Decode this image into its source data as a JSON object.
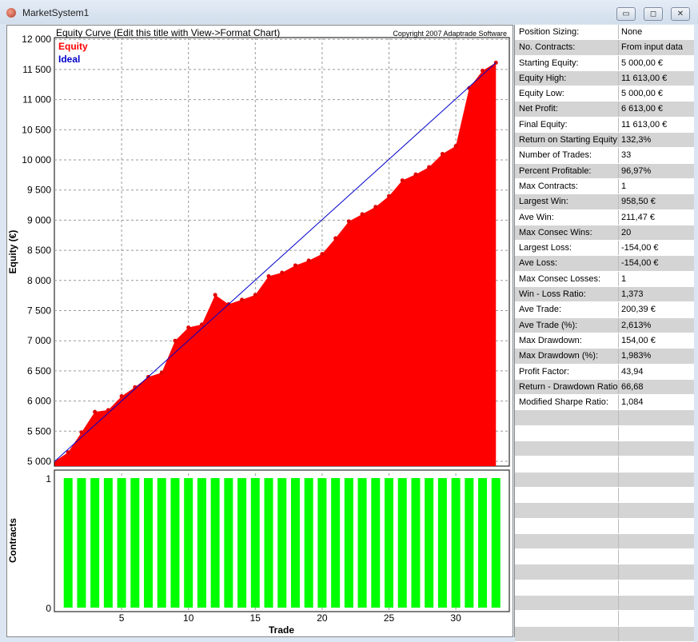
{
  "window": {
    "title": "MarketSystem1",
    "min_label": "▭",
    "max_label": "◻",
    "close_label": "✕"
  },
  "chart": {
    "title": "Equity Curve (Edit this title with View->Format Chart)",
    "copyright": "Copyright 2007 Adaptrade Software"
  },
  "chart_data": [
    {
      "type": "area",
      "title": "Equity Curve (Edit this title with View->Format Chart)",
      "xlabel": "",
      "ylabel": "Equity (€)",
      "ylim": [
        4900,
        12000
      ],
      "yticks": [
        5000,
        5500,
        6000,
        6500,
        7000,
        7500,
        8000,
        8500,
        9000,
        9500,
        10000,
        10500,
        11000,
        11500,
        12000
      ],
      "ytick_labels": [
        "5 000",
        "5 500",
        "6 000",
        "6 500",
        "7 000",
        "7 500",
        "8 000",
        "8 500",
        "9 000",
        "9 500",
        "10 000",
        "10 500",
        "11 000",
        "11 500",
        "12 000"
      ],
      "xlim": [
        0,
        34
      ],
      "grid": true,
      "legend": {
        "position": "top-left",
        "entries": [
          "Equity",
          "Ideal"
        ]
      },
      "series": [
        {
          "name": "Equity",
          "color": "#ff0000",
          "x": [
            0,
            1,
            2,
            3,
            4,
            5,
            6,
            7,
            8,
            9,
            10,
            11,
            12,
            13,
            14,
            15,
            16,
            17,
            18,
            19,
            20,
            21,
            22,
            23,
            24,
            25,
            26,
            27,
            28,
            29,
            30,
            31,
            32,
            33
          ],
          "values": [
            5000,
            5150,
            5480,
            5820,
            5850,
            6080,
            6230,
            6400,
            6470,
            7000,
            7220,
            7270,
            7760,
            7606,
            7680,
            7760,
            8070,
            8130,
            8250,
            8330,
            8440,
            8700,
            8980,
            9100,
            9220,
            9400,
            9660,
            9760,
            9880,
            10100,
            10230,
            11190,
            11480,
            11613
          ]
        },
        {
          "name": "Ideal",
          "color": "#0000cc",
          "x": [
            0,
            33
          ],
          "values": [
            5000,
            11613
          ]
        }
      ]
    },
    {
      "type": "bar",
      "title": "",
      "xlabel": "Trade",
      "ylabel": "Contracts",
      "ylim": [
        0,
        1
      ],
      "yticks": [
        "0",
        "1"
      ],
      "xticks": [
        "5",
        "10",
        "15",
        "20",
        "25",
        "30"
      ],
      "color": "#00ff00",
      "x": [
        1,
        2,
        3,
        4,
        5,
        6,
        7,
        8,
        9,
        10,
        11,
        12,
        13,
        14,
        15,
        16,
        17,
        18,
        19,
        20,
        21,
        22,
        23,
        24,
        25,
        26,
        27,
        28,
        29,
        30,
        31,
        32,
        33
      ],
      "values": [
        1,
        1,
        1,
        1,
        1,
        1,
        1,
        1,
        1,
        1,
        1,
        1,
        1,
        1,
        1,
        1,
        1,
        1,
        1,
        1,
        1,
        1,
        1,
        1,
        1,
        1,
        1,
        1,
        1,
        1,
        1,
        1,
        1
      ]
    }
  ],
  "stats": [
    {
      "k": "Position Sizing:",
      "v": "None"
    },
    {
      "k": "No. Contracts:",
      "v": "From input data"
    },
    {
      "k": "Starting Equity:",
      "v": "5 000,00 €"
    },
    {
      "k": "Equity High:",
      "v": "11 613,00 €"
    },
    {
      "k": "Equity Low:",
      "v": "5 000,00 €"
    },
    {
      "k": "Net Profit:",
      "v": "6 613,00 €"
    },
    {
      "k": "Final Equity:",
      "v": "11 613,00 €"
    },
    {
      "k": "Return on Starting Equity:",
      "v": "132,3%"
    },
    {
      "k": "Number of Trades:",
      "v": "33"
    },
    {
      "k": "Percent Profitable:",
      "v": "96,97%"
    },
    {
      "k": "Max Contracts:",
      "v": "1"
    },
    {
      "k": "Largest Win:",
      "v": "958,50 €"
    },
    {
      "k": "Ave Win:",
      "v": "211,47 €"
    },
    {
      "k": "Max Consec Wins:",
      "v": "20"
    },
    {
      "k": "Largest Loss:",
      "v": "-154,00 €"
    },
    {
      "k": "Ave Loss:",
      "v": "-154,00 €"
    },
    {
      "k": "Max Consec Losses:",
      "v": "1"
    },
    {
      "k": "Win - Loss Ratio:",
      "v": "1,373"
    },
    {
      "k": "Ave Trade:",
      "v": "200,39 €"
    },
    {
      "k": "Ave Trade (%):",
      "v": "2,613%"
    },
    {
      "k": "Max Drawdown:",
      "v": "154,00 €"
    },
    {
      "k": "Max Drawdown (%):",
      "v": "1,983%"
    },
    {
      "k": "Profit Factor:",
      "v": "43,94"
    },
    {
      "k": "Return - Drawdown Ratio:",
      "v": "66,68"
    },
    {
      "k": "Modified Sharpe Ratio:",
      "v": "1,084"
    }
  ]
}
